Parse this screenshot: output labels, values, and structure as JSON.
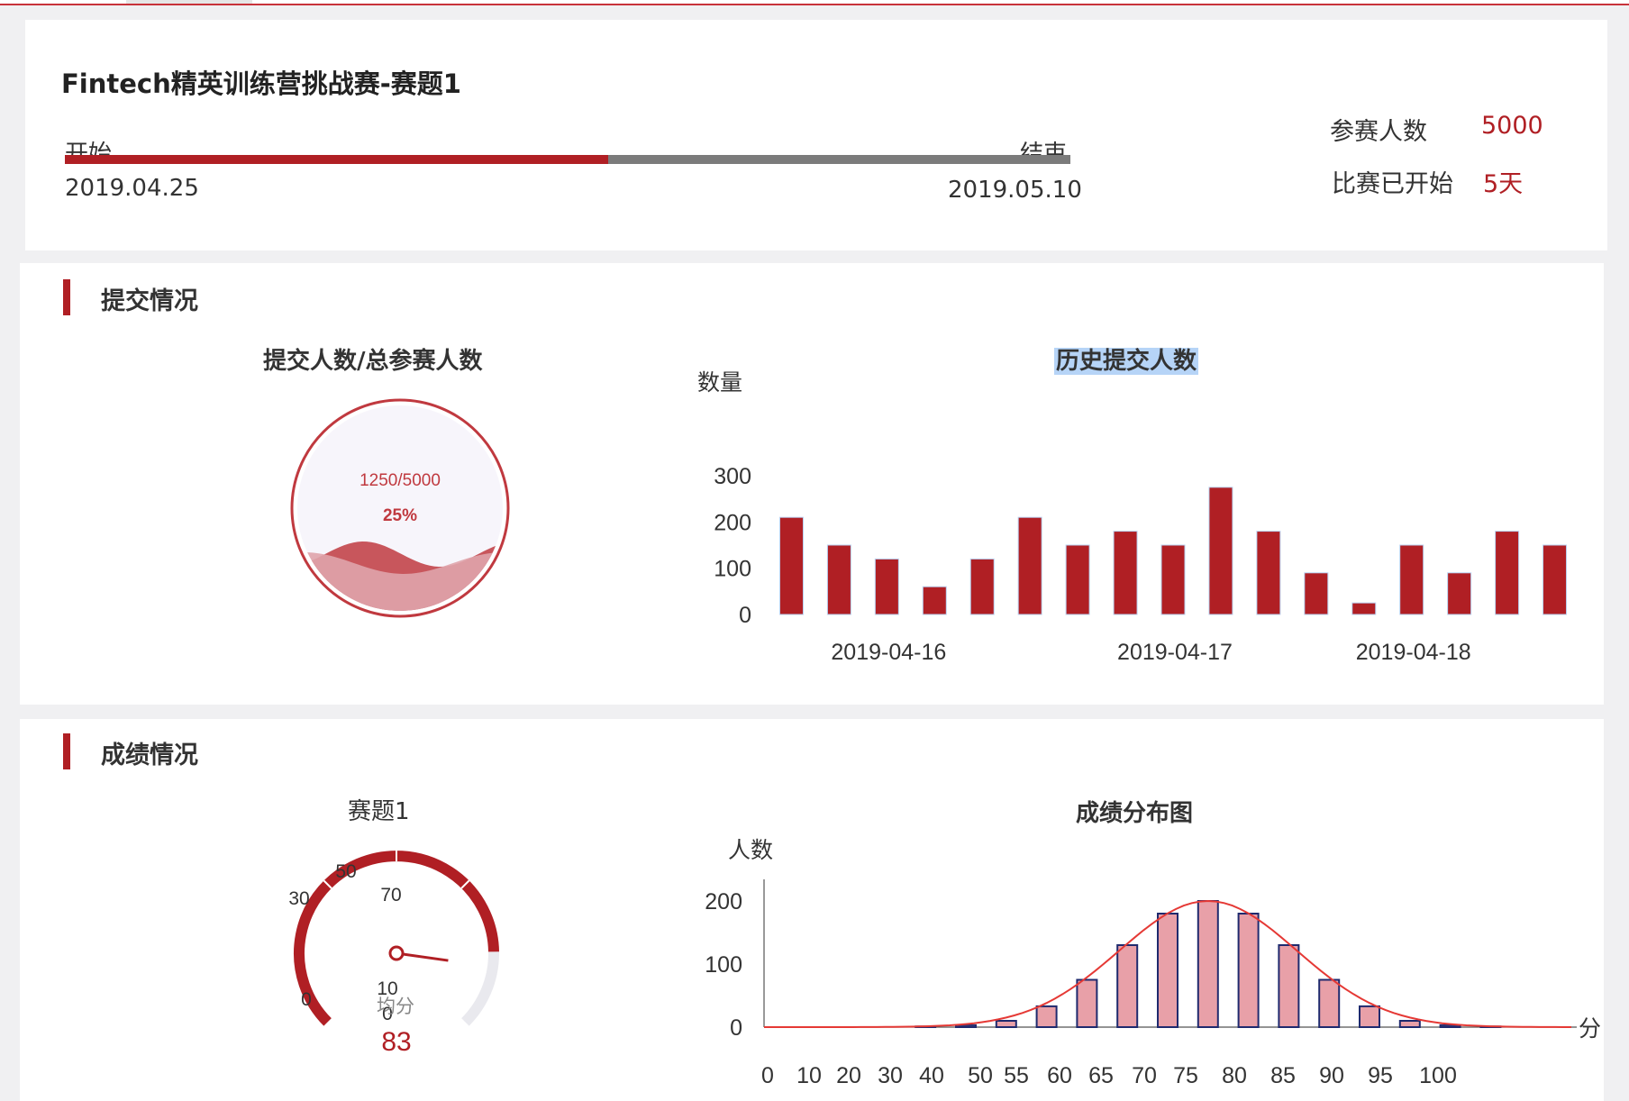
{
  "header": {
    "contest_title": "Fintech精英训练营挑战赛-赛题1",
    "start_label": "开始",
    "end_label": "结束",
    "start_date": "2019.04.25",
    "end_date": "2019.05.10",
    "progress_fraction": 0.54,
    "participants_label": "参赛人数",
    "participants_value": "5000",
    "started_label": "比赛已开始",
    "started_value": "5天"
  },
  "colors": {
    "accent": "#b01f24",
    "track": "#7b7b7b",
    "bar_fill_light": "#e8a0a8",
    "bar_outline": "#1f2a6e",
    "curve": "#e53935"
  },
  "submission": {
    "section_title": "提交情况",
    "ratio_chart": {
      "title": "提交人数/总参赛人数",
      "ratio_text": "1250/5000",
      "percent_text": "25%",
      "fill_fraction": 0.25
    },
    "history_chart_title": "历史提交人数"
  },
  "scores": {
    "section_title": "成绩情况",
    "gauge": {
      "title": "赛题1",
      "avg_label": "均分",
      "avg_value": "83",
      "ticks": [
        "0",
        "30",
        "50",
        "70",
        "10\n0"
      ],
      "value_fraction": 0.83
    },
    "distribution_title": "成绩分布图"
  },
  "chart_data": [
    {
      "type": "bar",
      "title": "历史提交人数",
      "ylabel": "数量",
      "ylim": [
        0,
        300
      ],
      "yticks": [
        0,
        100,
        200,
        300
      ],
      "xtick_labels": [
        "2019-04-16",
        "2019-04-17",
        "2019-04-18"
      ],
      "xtick_positions": [
        2,
        8,
        13
      ],
      "values": [
        210,
        150,
        120,
        60,
        120,
        210,
        150,
        180,
        150,
        275,
        180,
        90,
        25,
        150,
        90,
        180,
        150
      ],
      "grid": false
    },
    {
      "type": "bar",
      "title": "成绩分布图",
      "xlabel": "分数",
      "ylabel": "人数",
      "ylim": [
        0,
        200
      ],
      "yticks": [
        0,
        100,
        200
      ],
      "xticks": [
        "0",
        "10",
        "20",
        "30",
        "40",
        "50",
        "55",
        "60",
        "65",
        "70",
        "75",
        "80",
        "85",
        "90",
        "95",
        "100"
      ],
      "categories": [
        0,
        5,
        10,
        15,
        20,
        25,
        30,
        35,
        40,
        45,
        50,
        55,
        60,
        65,
        70,
        75,
        80,
        85,
        90,
        95,
        100
      ],
      "values": [
        0,
        0,
        0,
        0,
        1,
        3,
        10,
        33,
        75,
        130,
        180,
        200,
        180,
        130,
        75,
        33,
        10,
        3,
        1,
        0,
        0
      ],
      "overlay": "normal-curve",
      "grid": false
    }
  ]
}
